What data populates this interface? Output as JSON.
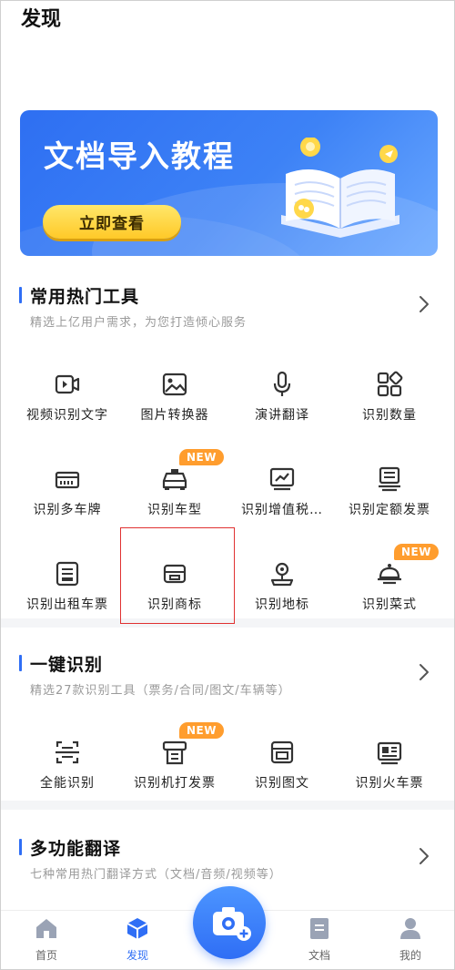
{
  "header": {
    "title": "发现"
  },
  "banner": {
    "title": "文档导入教程",
    "button_label": "立即查看"
  },
  "section1": {
    "title": "常用热门工具",
    "subtitle": "精选上亿用户需求，为您打造倾心服务",
    "tools": [
      {
        "label": "视频识别文字",
        "icon": "video-icon"
      },
      {
        "label": "图片转换器",
        "icon": "image-icon"
      },
      {
        "label": "演讲翻译",
        "icon": "microphone-icon"
      },
      {
        "label": "识别数量",
        "icon": "apps-icon"
      },
      {
        "label": "识别多车牌",
        "icon": "license-plate-icon"
      },
      {
        "label": "识别车型",
        "icon": "taxi-icon",
        "badge": "NEW"
      },
      {
        "label": "识别增值税…",
        "icon": "invoice-chart-icon"
      },
      {
        "label": "识别定额发票",
        "icon": "receipt-icon"
      },
      {
        "label": "识别出租车票",
        "icon": "taxi-ticket-icon"
      },
      {
        "label": "识别商标",
        "icon": "trademark-icon"
      },
      {
        "label": "识别地标",
        "icon": "landmark-icon"
      },
      {
        "label": "识别菜式",
        "icon": "dish-icon",
        "badge": "NEW"
      }
    ]
  },
  "section2": {
    "title": "一键识别",
    "subtitle": "精选27款识别工具（票务/合同/图文/车辆等）",
    "tools": [
      {
        "label": "全能识别",
        "icon": "scan-icon"
      },
      {
        "label": "识别机打发票",
        "icon": "printer-invoice-icon",
        "badge": "NEW"
      },
      {
        "label": "识别图文",
        "icon": "image-text-icon"
      },
      {
        "label": "识别火车票",
        "icon": "train-ticket-icon"
      }
    ]
  },
  "section3": {
    "title": "多功能翻译",
    "subtitle": "七种常用热门翻译方式（文档/音频/视频等）"
  },
  "tabbar": {
    "items": [
      {
        "label": "首页",
        "icon": "home-icon"
      },
      {
        "label": "发现",
        "icon": "discover-cube-icon",
        "active": true
      },
      {
        "label": "文档",
        "icon": "document-icon"
      },
      {
        "label": "我的",
        "icon": "user-icon"
      }
    ],
    "camera_icon": "camera-plus-icon"
  },
  "colors": {
    "accent": "#2f6ef5",
    "badge": "#ff9d2e",
    "highlight": "#e03131"
  }
}
